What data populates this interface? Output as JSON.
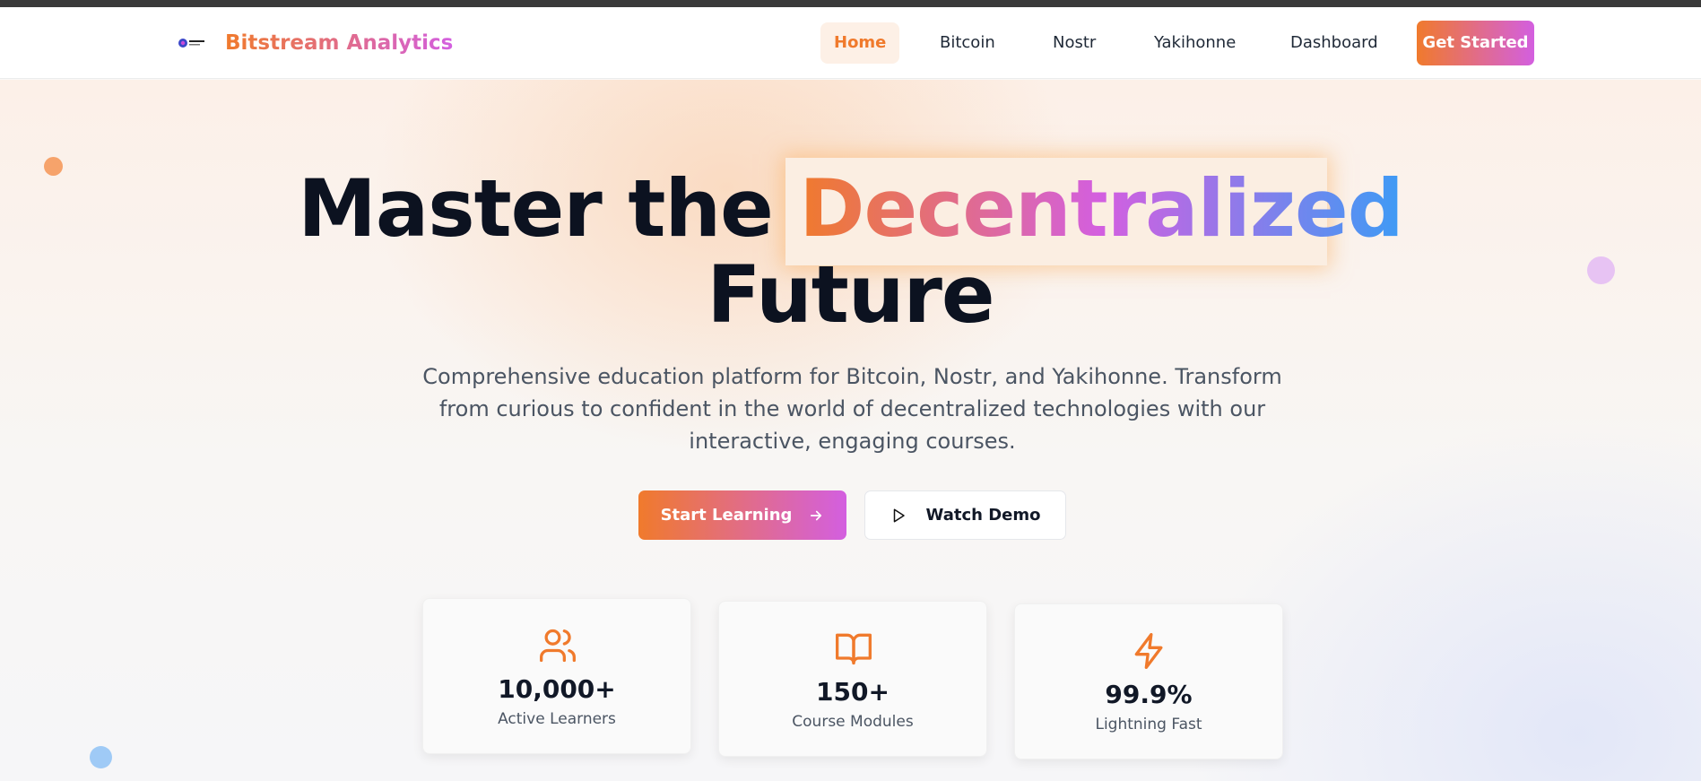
{
  "header": {
    "brand": "Bitstream Analytics",
    "nav": [
      "Home",
      "Bitcoin",
      "Nostr",
      "Yakihonne",
      "Dashboard"
    ],
    "active_nav": "Home",
    "cta_label": "Get Started"
  },
  "hero": {
    "title_part1": "Master the",
    "title_highlight": "Decentralized",
    "title_part2": "Future",
    "subtitle": "Comprehensive education platform for Bitcoin, Nostr, and Yakihonne. Transform from curious to confident in the world of decentralized technologies with our interactive, engaging courses.",
    "primary_button": "Start Learning",
    "secondary_button": "Watch Demo"
  },
  "stats": [
    {
      "icon": "users-icon",
      "value": "10,000+",
      "label": "Active Learners"
    },
    {
      "icon": "book-open-icon",
      "value": "150+",
      "label": "Course Modules"
    },
    {
      "icon": "zap-icon",
      "value": "99.9%",
      "label": "Lightning Fast"
    }
  ],
  "colors": {
    "accent_orange": "#f07a2c",
    "accent_purple": "#d35fe0",
    "accent_blue": "#3d9bf5"
  }
}
